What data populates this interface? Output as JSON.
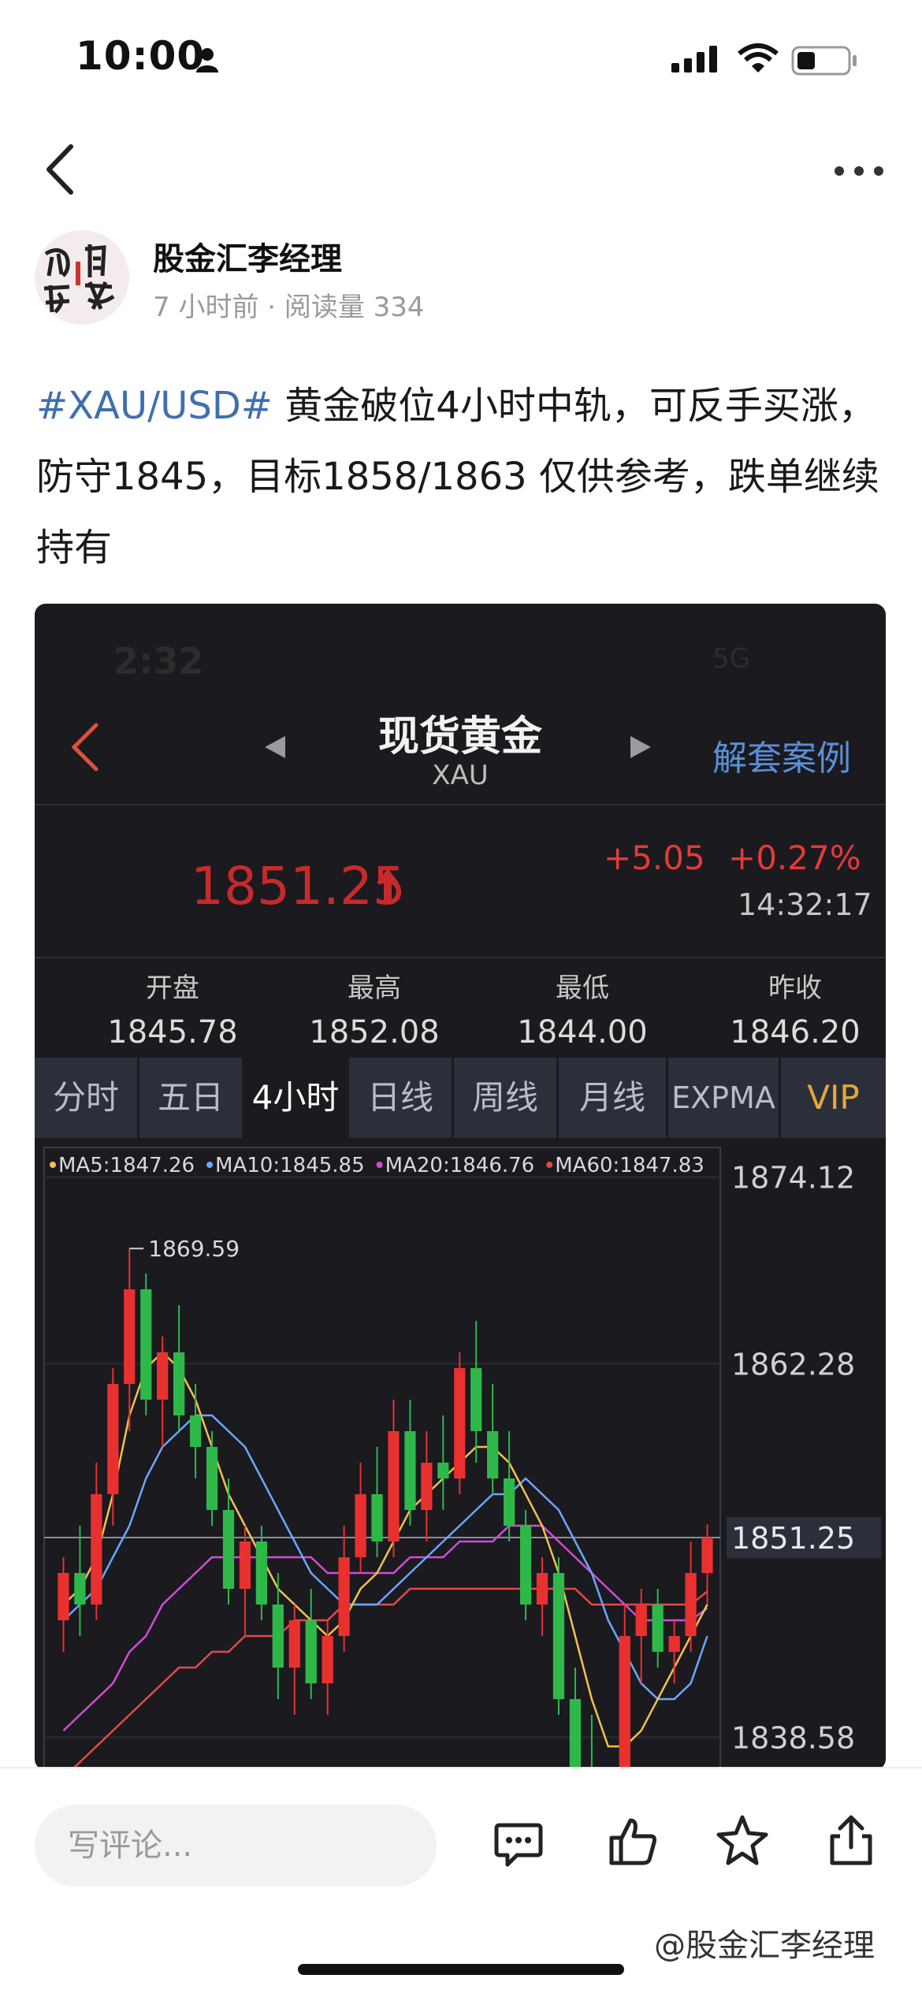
{
  "status": {
    "time": "10:00"
  },
  "post": {
    "author": "股金汇李经理",
    "meta": "7 小时前 · 阅读量 334",
    "tag": "#XAU/USD#",
    "text": " 黄金破位4小时中轨，可反手买涨，防守1845，目标1858/1863 仅供参考，跌单继续持有"
  },
  "shot": {
    "time": "2:32",
    "network": "5G",
    "title": "现货黄金",
    "subtitle": "XAU",
    "case_link": "解套案例",
    "price": "1851.25",
    "change": "+5.05",
    "change_pct": "+0.27%",
    "clock": "14:32:17",
    "stats": [
      {
        "label": "开盘",
        "value": "1845.78"
      },
      {
        "label": "最高",
        "value": "1852.08"
      },
      {
        "label": "最低",
        "value": "1844.00"
      },
      {
        "label": "昨收",
        "value": "1846.20"
      }
    ],
    "tabs": [
      "分时",
      "五日",
      "4小时",
      "日线",
      "周线",
      "月线",
      "EXPMA",
      "VIP"
    ],
    "active_tab": "4小时"
  },
  "chart_data": {
    "type": "candlestick",
    "ma_legend": [
      {
        "label": "MA5:1847.26",
        "color": "#f2c14e"
      },
      {
        "label": "MA10:1845.85",
        "color": "#6aa7ff"
      },
      {
        "label": "MA20:1846.76",
        "color": "#d24bd8"
      },
      {
        "label": "MA60:1847.83",
        "color": "#e04a4a"
      }
    ],
    "y_ticks": [
      "1874.12",
      "1862.28",
      "1851.25",
      "1838.58"
    ],
    "y_tick_values": [
      1874.12,
      1862.28,
      1851.25,
      1838.58
    ],
    "current_price": 1851.25,
    "high_marker": "1869.59",
    "ylim": [
      1836.5,
      1876.0
    ],
    "candles": [
      [
        1846,
        1850,
        1844,
        1849
      ],
      [
        1849,
        1852,
        1845,
        1847
      ],
      [
        1847,
        1856,
        1846,
        1854
      ],
      [
        1854,
        1862,
        1852,
        1861
      ],
      [
        1861,
        1869.59,
        1858,
        1867
      ],
      [
        1867,
        1868,
        1859,
        1860
      ],
      [
        1860,
        1864,
        1857,
        1863
      ],
      [
        1863,
        1866,
        1858,
        1859
      ],
      [
        1859,
        1861,
        1855,
        1857
      ],
      [
        1857,
        1858,
        1852,
        1853
      ],
      [
        1853,
        1855,
        1847,
        1848
      ],
      [
        1848,
        1852,
        1845,
        1851
      ],
      [
        1851,
        1852,
        1846,
        1847
      ],
      [
        1847,
        1849,
        1841,
        1843
      ],
      [
        1843,
        1847,
        1840,
        1846
      ],
      [
        1846,
        1848,
        1841,
        1842
      ],
      [
        1842,
        1846,
        1840,
        1845
      ],
      [
        1845,
        1852,
        1844,
        1850
      ],
      [
        1850,
        1856,
        1849,
        1854
      ],
      [
        1854,
        1857,
        1850,
        1851
      ],
      [
        1851,
        1860,
        1850,
        1858
      ],
      [
        1858,
        1860,
        1852,
        1853
      ],
      [
        1853,
        1858,
        1851,
        1856
      ],
      [
        1856,
        1859,
        1853,
        1855
      ],
      [
        1855,
        1863,
        1854,
        1862
      ],
      [
        1862,
        1865,
        1856,
        1858
      ],
      [
        1858,
        1861,
        1854,
        1855
      ],
      [
        1855,
        1858,
        1851,
        1852
      ],
      [
        1852,
        1853,
        1846,
        1847
      ],
      [
        1847,
        1850,
        1845,
        1849
      ],
      [
        1849,
        1850,
        1840,
        1841
      ],
      [
        1841,
        1843,
        1834,
        1836
      ],
      [
        1836,
        1840,
        1832,
        1834
      ],
      [
        1834,
        1836,
        1832,
        1835
      ],
      [
        1835,
        1847,
        1834,
        1845
      ],
      [
        1845,
        1848,
        1842,
        1847
      ],
      [
        1847,
        1848,
        1843,
        1844
      ],
      [
        1844,
        1846,
        1842,
        1845
      ],
      [
        1845,
        1851,
        1844,
        1849
      ],
      [
        1849,
        1852.08,
        1847,
        1851.25
      ]
    ],
    "ma_lines": {
      "ma5": [
        1847,
        1848,
        1850,
        1854,
        1859,
        1862,
        1863,
        1862,
        1860,
        1857,
        1854,
        1852,
        1850,
        1848,
        1847,
        1846,
        1845,
        1846,
        1848,
        1849,
        1851,
        1853,
        1854,
        1855,
        1856,
        1857,
        1857,
        1856,
        1854,
        1852,
        1849,
        1845,
        1841,
        1838,
        1838,
        1839,
        1841,
        1843,
        1845,
        1847
      ],
      "ma10": [
        1846,
        1847,
        1848,
        1850,
        1852,
        1855,
        1857,
        1858,
        1859,
        1859,
        1858,
        1857,
        1855,
        1853,
        1851,
        1849,
        1848,
        1847,
        1847,
        1847,
        1848,
        1849,
        1850,
        1851,
        1852,
        1853,
        1854,
        1854,
        1855,
        1854,
        1853,
        1851,
        1849,
        1846,
        1844,
        1842,
        1841,
        1841,
        1842,
        1845
      ],
      "ma20": [
        1839,
        1840,
        1841,
        1842,
        1844,
        1845,
        1847,
        1848,
        1849,
        1850,
        1850,
        1850,
        1850,
        1850,
        1850,
        1850,
        1849,
        1849,
        1849,
        1849,
        1849,
        1850,
        1850,
        1850,
        1851,
        1851,
        1851,
        1852,
        1852,
        1852,
        1851,
        1850,
        1849,
        1848,
        1847,
        1846,
        1846,
        1846,
        1846,
        1846.76
      ],
      "ma60": [
        1836,
        1837,
        1838,
        1839,
        1840,
        1841,
        1842,
        1843,
        1843,
        1844,
        1844,
        1845,
        1845,
        1845,
        1846,
        1846,
        1846,
        1847,
        1847,
        1847,
        1847,
        1848,
        1848,
        1848,
        1848,
        1848,
        1848,
        1848,
        1848,
        1848,
        1848,
        1848,
        1847,
        1847,
        1847,
        1847,
        1847,
        1847,
        1847,
        1847.83
      ]
    }
  },
  "comment": {
    "placeholder": "写评论..."
  },
  "watermark": "@股金汇李经理"
}
